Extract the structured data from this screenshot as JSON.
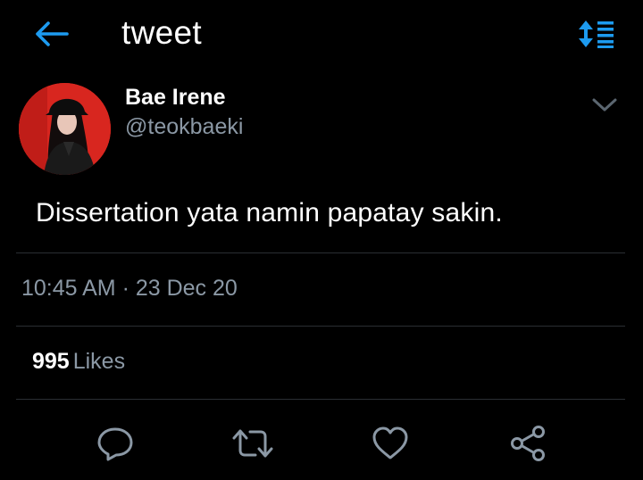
{
  "header": {
    "title": "tweet",
    "back_icon": "arrow-left-icon",
    "sort_icon": "sort-lines-icon",
    "accent_color": "#1d9bf0"
  },
  "tweet": {
    "author": {
      "display_name": "Bae Irene",
      "handle": "@teokbaeki"
    },
    "text": "Dissertation yata namin papatay sakin.",
    "timestamp": "10:45 AM · 23 Dec 20",
    "likes": {
      "count": "995",
      "label": "Likes"
    }
  },
  "actions": [
    {
      "icon": "reply-bubble-icon"
    },
    {
      "icon": "retweet-icon"
    },
    {
      "icon": "heart-icon"
    },
    {
      "icon": "share-icon"
    }
  ],
  "colors": {
    "background": "#000000",
    "primary_text": "#ffffff",
    "secondary_text": "#8b98a5",
    "divider": "#2a2e33",
    "avatar_background": "#d8261f"
  }
}
